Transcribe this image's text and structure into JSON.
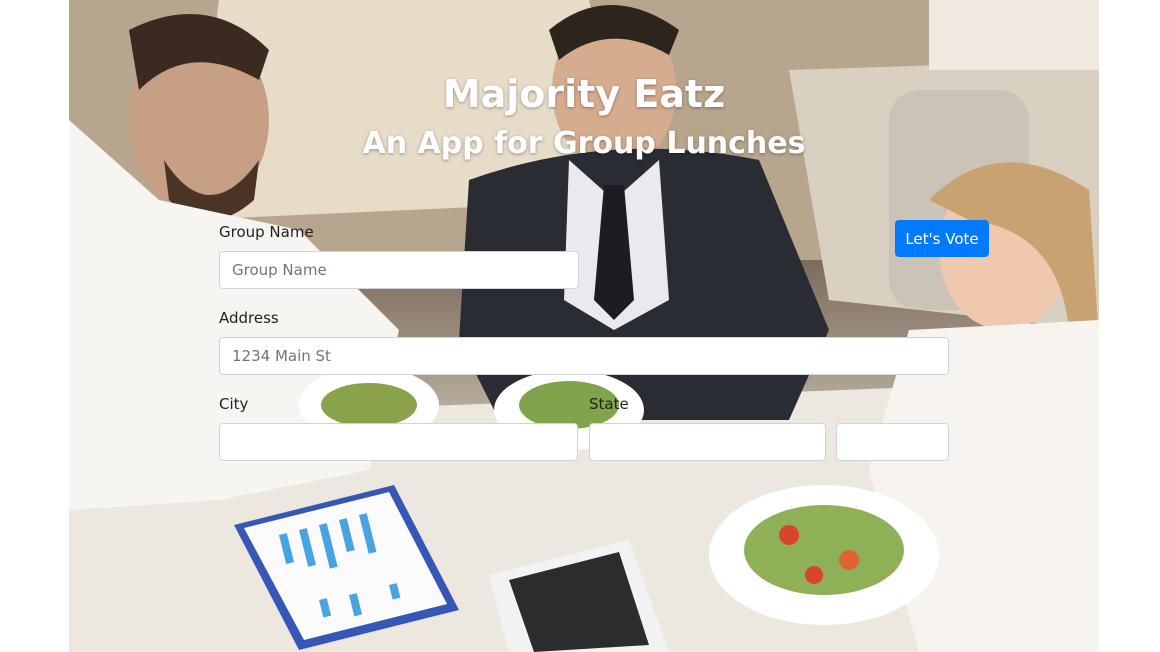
{
  "header": {
    "title": "Majority Eatz",
    "subtitle": "An App for Group Lunches"
  },
  "form": {
    "group_name": {
      "label": "Group Name",
      "placeholder": "Group Name",
      "value": ""
    },
    "address": {
      "label": "Address",
      "placeholder": "1234 Main St",
      "value": ""
    },
    "city": {
      "label": "City",
      "value": ""
    },
    "state": {
      "label": "State",
      "value": ""
    },
    "zip": {
      "value": ""
    }
  },
  "actions": {
    "vote_label": "Let's Vote"
  },
  "colors": {
    "primary": "#007bff",
    "text_on_hero": "#ffffff",
    "input_border": "#ced4da"
  }
}
